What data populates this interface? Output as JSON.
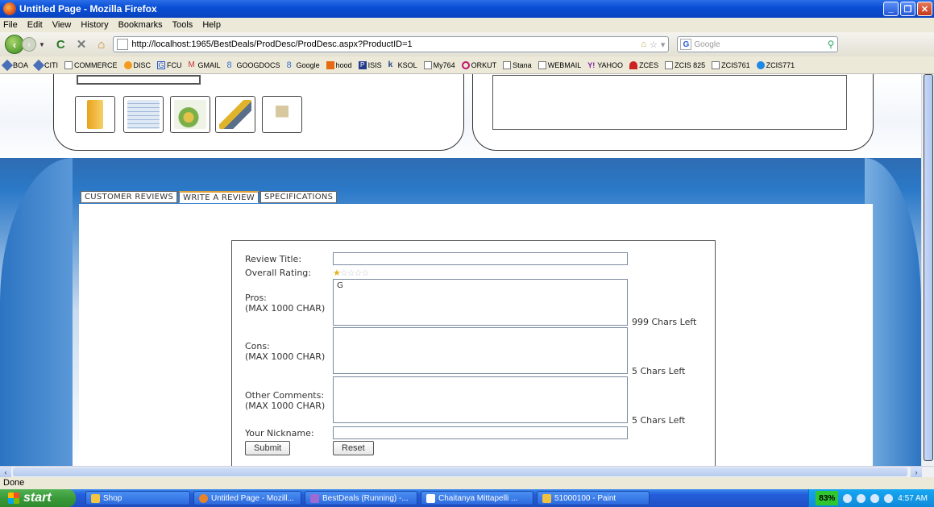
{
  "window": {
    "title": "Untitled Page - Mozilla Firefox"
  },
  "menu": [
    "File",
    "Edit",
    "View",
    "History",
    "Bookmarks",
    "Tools",
    "Help"
  ],
  "nav": {
    "url": "http://localhost:1965/BestDeals/ProdDesc/ProdDesc.aspx?ProductID=1",
    "search_placeholder": "Google"
  },
  "bookmarks": [
    "BOA",
    "CITI",
    "COMMERCE",
    "DISC",
    "FCU",
    "GMAIL",
    "GOOGDOCS",
    "Google",
    "hood",
    "ISIS",
    "KSOL",
    "My764",
    "ORKUT",
    "Stana",
    "WEBMAIL",
    "YAHOO",
    "ZCES",
    "ZCIS 825",
    "ZCIS761",
    "ZCIS771"
  ],
  "tabs": [
    "CUSTOMER REVIEWS",
    "WRITE A REVIEW",
    "SPECIFICATIONS"
  ],
  "form": {
    "review_title_label": "Review Title:",
    "overall_rating_label": "Overall Rating:",
    "rating": 1,
    "rating_max": 5,
    "pros_label": "Pros:\n(MAX 1000 CHAR)",
    "pros_value": "G",
    "pros_chars_left": "999 Chars Left",
    "cons_label": "Cons:\n(MAX 1000 CHAR)",
    "cons_chars_left": "5 Chars Left",
    "other_label": "Other Comments:\n(MAX 1000 CHAR)",
    "other_chars_left": "5 Chars Left",
    "nickname_label": "Your Nickname:",
    "submit_label": "Submit",
    "reset_label": "Reset"
  },
  "status": {
    "text": "Done"
  },
  "taskbar": {
    "start_label": "start",
    "tasks": [
      "Shop",
      "Untitled Page - Mozill...",
      "BestDeals (Running) -...",
      "Chaitanya Mittapelli ...",
      "51000100 - Paint"
    ],
    "battery": "83%",
    "clock": "4:57 AM"
  },
  "colors": {
    "accent": "#245edb",
    "tab_active_border": "#e0a13a",
    "hero_blue": "#2b79c8"
  }
}
